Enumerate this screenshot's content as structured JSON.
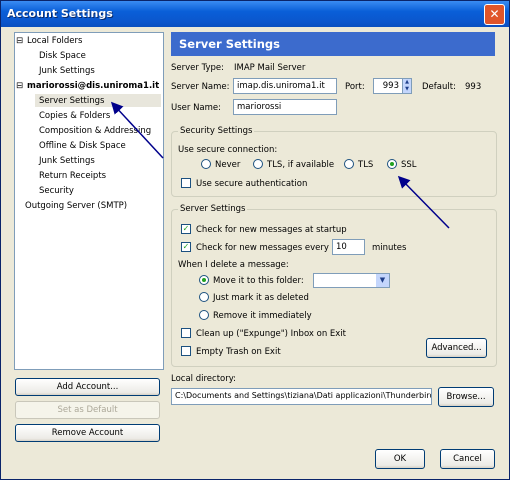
{
  "window": {
    "title": "Account Settings",
    "close_glyph": "✕"
  },
  "tree": {
    "items": [
      {
        "label": "Local Folders",
        "toggle": "⊟"
      },
      {
        "label": "Disk Space"
      },
      {
        "label": "Junk Settings"
      },
      {
        "label": "mariorossi@dis.uniroma1.it",
        "toggle": "⊟"
      },
      {
        "label": "Server Settings"
      },
      {
        "label": "Copies & Folders"
      },
      {
        "label": "Composition & Addressing"
      },
      {
        "label": "Offline & Disk Space"
      },
      {
        "label": "Junk Settings"
      },
      {
        "label": "Return Receipts"
      },
      {
        "label": "Security"
      },
      {
        "label": "Outgoing Server (SMTP)"
      }
    ]
  },
  "account_buttons": {
    "add": "Add Account...",
    "default": "Set as Default",
    "remove": "Remove Account"
  },
  "header": {
    "title": "Server Settings"
  },
  "server": {
    "type_label": "Server Type:",
    "type_value": "IMAP Mail Server",
    "name_label": "Server Name:",
    "name_value": "imap.dis.uniroma1.it",
    "port_label": "Port:",
    "port_value": "993",
    "default_label": "Default:",
    "default_value": "993",
    "user_label": "User Name:",
    "user_value": "mariorossi"
  },
  "security": {
    "legend": "Security Settings",
    "use_secure": "Use secure connection:",
    "options": [
      "Never",
      "TLS, if available",
      "TLS",
      "SSL"
    ],
    "selected": "SSL",
    "auth_label": "Use secure authentication"
  },
  "settings": {
    "legend": "Server Settings",
    "check_startup": "Check for new messages at startup",
    "check_every": "Check for new messages every",
    "minutes_value": "10",
    "minutes_label": "minutes",
    "delete_label": "When I delete a message:",
    "move_label": "Move it to this folder:",
    "mark_label": "Just mark it as deleted",
    "remove_label": "Remove it immediately",
    "cleanup_label": "Clean up (\"Expunge\") Inbox on Exit",
    "empty_trash_label": "Empty Trash on Exit",
    "advanced": "Advanced..."
  },
  "local_dir": {
    "label": "Local directory:",
    "value": "C:\\Documents and Settings\\tiziana\\Dati applicazioni\\Thunderbird",
    "browse": "Browse..."
  },
  "footer": {
    "ok": "OK",
    "cancel": "Cancel"
  }
}
